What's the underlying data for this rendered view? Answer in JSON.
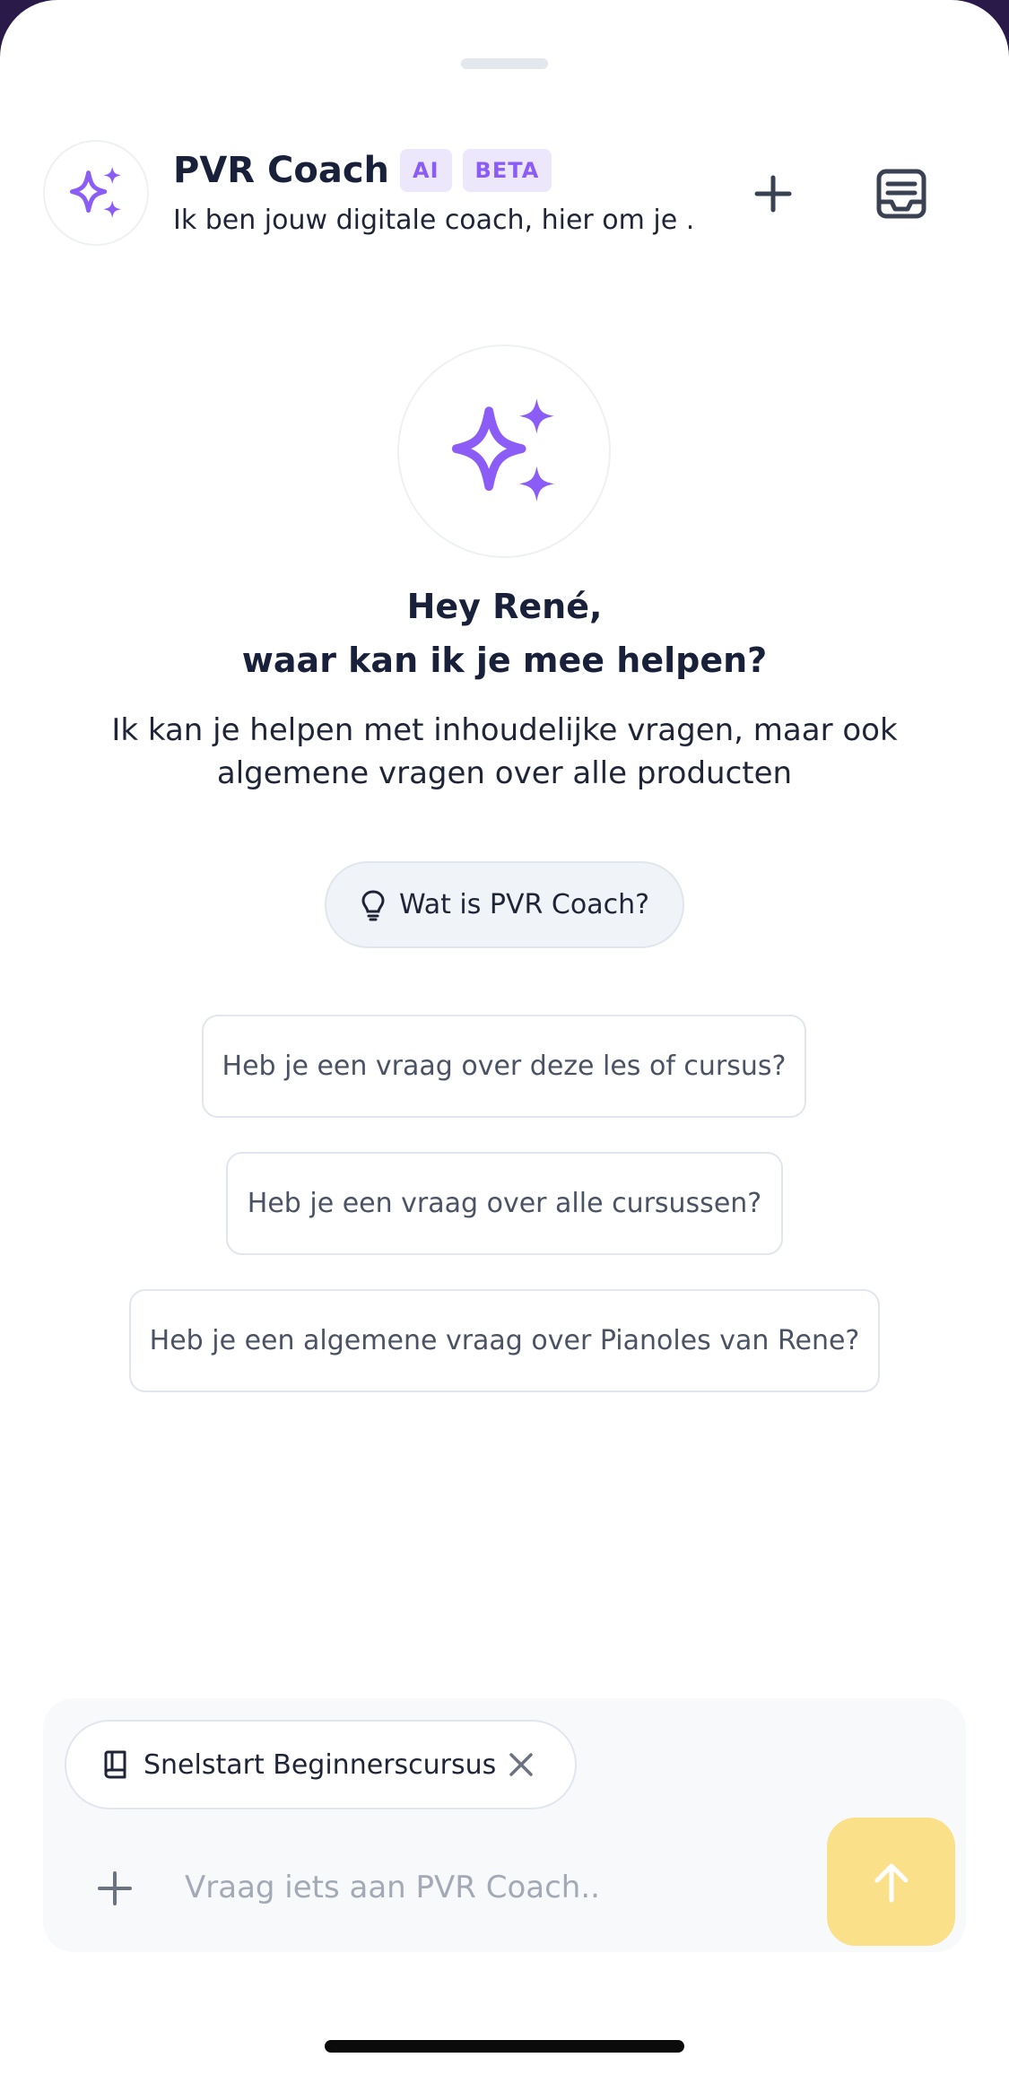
{
  "header": {
    "title": "PVR Coach",
    "badge_ai": "AI",
    "badge_beta": "BETA",
    "subtitle": "Ik ben jouw digitale coach, hier om je ...",
    "avatar_icon": "sparkles-icon",
    "new_chat_icon": "plus-icon",
    "history_icon": "inbox-icon"
  },
  "hero": {
    "icon": "sparkles-icon",
    "greeting_line1": "Hey René,",
    "greeting_line2": "waar kan ik je mee helpen?",
    "description": "Ik kan je helpen met inhoudelijke vragen, maar ook algemene vragen over alle producten"
  },
  "what_is": {
    "icon": "lightbulb-icon",
    "label": "Wat is PVR Coach?"
  },
  "suggestions": [
    "Heb je een vraag over deze les of cursus?",
    "Heb je een vraag over alle cursussen?",
    "Heb je een algemene vraag over Pianoles van Rene?"
  ],
  "composer": {
    "context_icon": "book-icon",
    "context_label": "Snelstart Beginnerscursus",
    "placeholder": "Vraag iets aan PVR Coach..",
    "value": ""
  },
  "colors": {
    "accent": "#8b5cf6",
    "badge_bg": "#ede7fb",
    "send_button": "#fbe08a",
    "text_dark": "#18203a"
  }
}
